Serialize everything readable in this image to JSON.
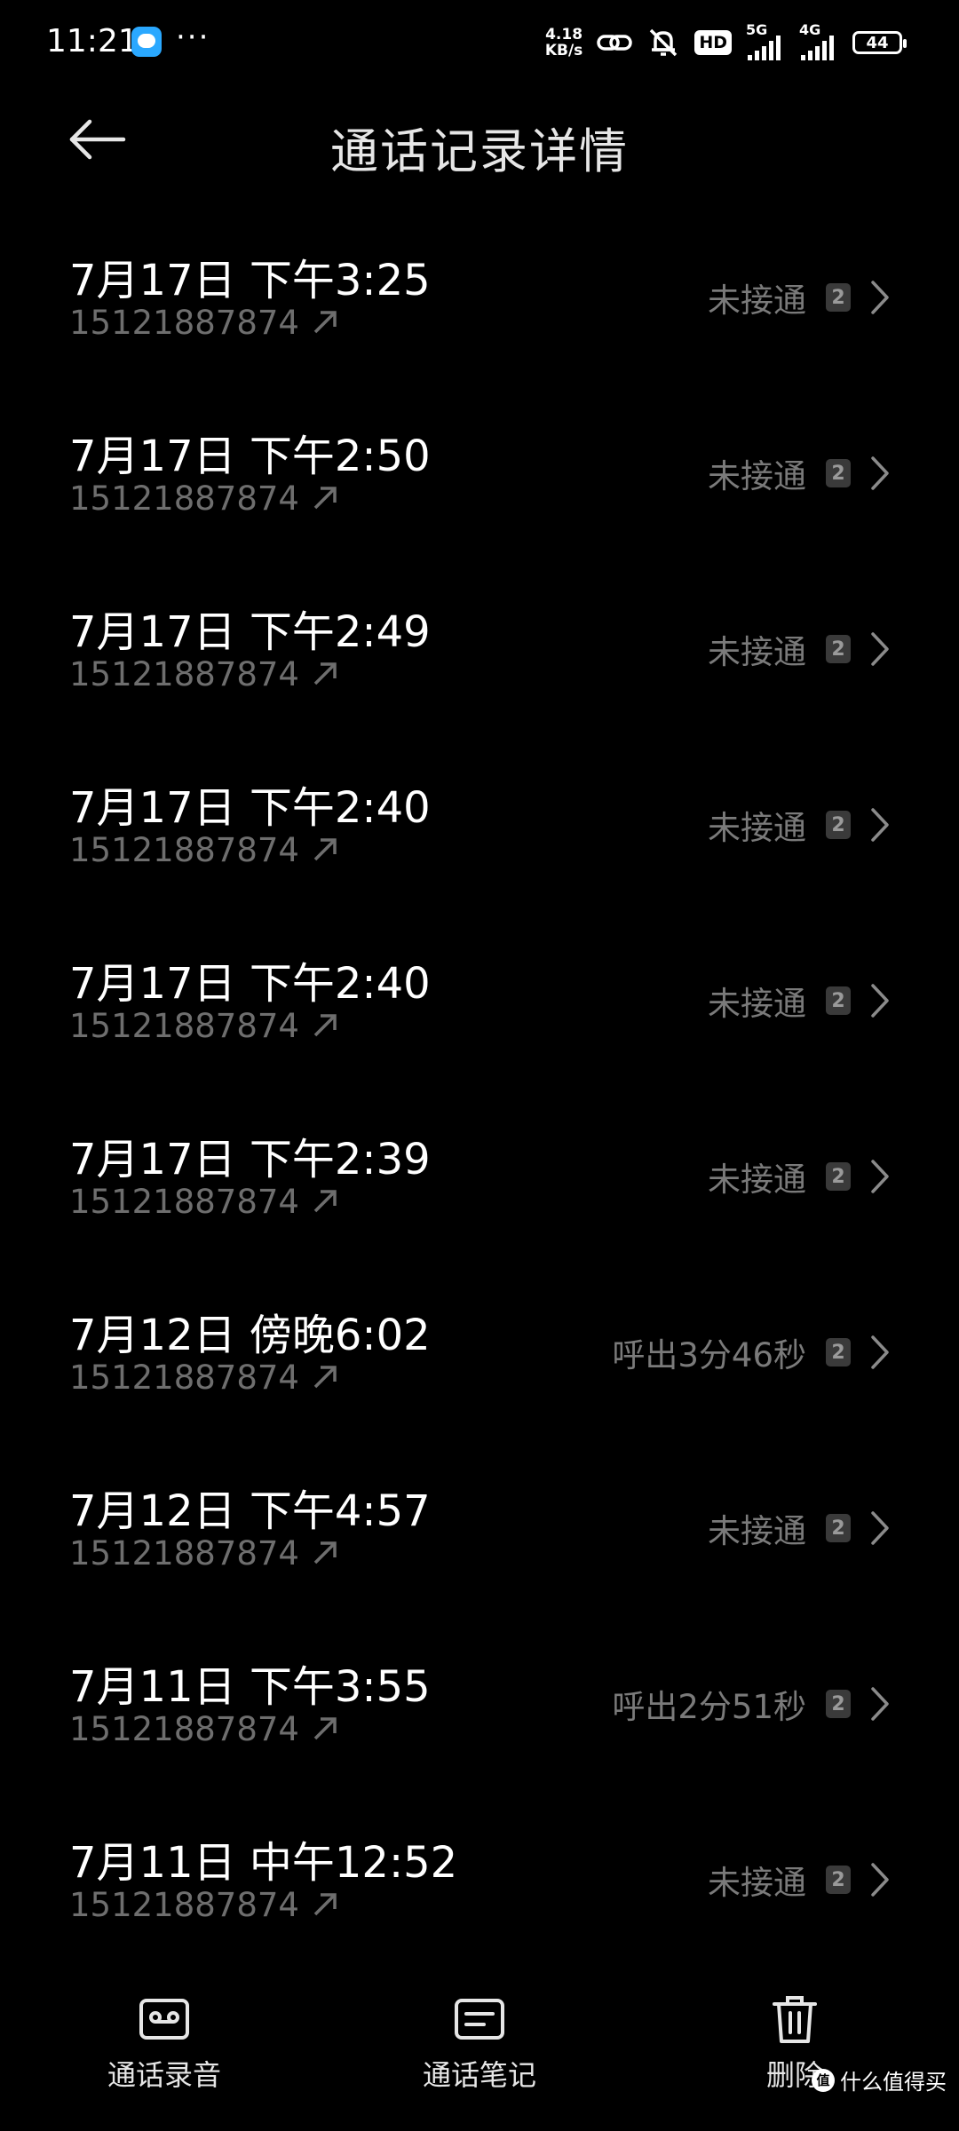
{
  "status_bar": {
    "time": "11:21",
    "more": "···",
    "net_speed_value": "4.18",
    "net_speed_unit": "KB/s",
    "hd_label": "HD",
    "sig1_label": "5G",
    "sig2_label": "4G",
    "battery": "44"
  },
  "header": {
    "title": "通话记录详情"
  },
  "calls": [
    {
      "datetime": "7月17日 下午3:25",
      "number": "15121887874",
      "status": "未接通",
      "sim": "2"
    },
    {
      "datetime": "7月17日 下午2:50",
      "number": "15121887874",
      "status": "未接通",
      "sim": "2"
    },
    {
      "datetime": "7月17日 下午2:49",
      "number": "15121887874",
      "status": "未接通",
      "sim": "2"
    },
    {
      "datetime": "7月17日 下午2:40",
      "number": "15121887874",
      "status": "未接通",
      "sim": "2"
    },
    {
      "datetime": "7月17日 下午2:40",
      "number": "15121887874",
      "status": "未接通",
      "sim": "2"
    },
    {
      "datetime": "7月17日 下午2:39",
      "number": "15121887874",
      "status": "未接通",
      "sim": "2"
    },
    {
      "datetime": "7月12日 傍晚6:02",
      "number": "15121887874",
      "status": "呼出3分46秒",
      "sim": "2"
    },
    {
      "datetime": "7月12日 下午4:57",
      "number": "15121887874",
      "status": "未接通",
      "sim": "2"
    },
    {
      "datetime": "7月11日 下午3:55",
      "number": "15121887874",
      "status": "呼出2分51秒",
      "sim": "2"
    },
    {
      "datetime": "7月11日 中午12:52",
      "number": "15121887874",
      "status": "未接通",
      "sim": "2"
    }
  ],
  "bottom_bar": {
    "recording_label": "通话录音",
    "notes_label": "通话笔记",
    "delete_label": "删除"
  },
  "watermark": {
    "logo": "值",
    "text": "什么值得买"
  },
  "icons": {
    "back": "back-arrow-icon",
    "outgoing": "outgoing-call-arrow-icon",
    "chevron": "chevron-right-icon",
    "recording": "cassette-tape-icon",
    "notes": "note-card-icon",
    "delete": "trash-can-icon"
  },
  "colors": {
    "background": "#000000",
    "primary_text": "#ffffff",
    "secondary_text": "#6e6e6e",
    "status_text": "#7a7a7a",
    "badge_bg": "#3a3a3a"
  }
}
